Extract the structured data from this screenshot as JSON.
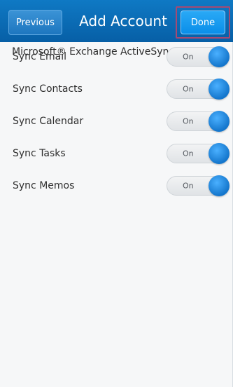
{
  "header": {
    "previous_label": "Previous",
    "title": "Add Account",
    "done_label": "Done"
  },
  "section": {
    "title": "Microsoft® Exchange ActiveSync"
  },
  "settings": [
    {
      "label": "Sync Email",
      "state": "On"
    },
    {
      "label": "Sync Contacts",
      "state": "On"
    },
    {
      "label": "Sync Calendar",
      "state": "On"
    },
    {
      "label": "Sync Tasks",
      "state": "On"
    },
    {
      "label": "Sync Memos",
      "state": "On"
    }
  ],
  "colors": {
    "title_bar": "#0a6db8",
    "done_button": "#1a9cf0",
    "toggle_knob": "#1a86de",
    "done_highlight": "#a54a73"
  }
}
